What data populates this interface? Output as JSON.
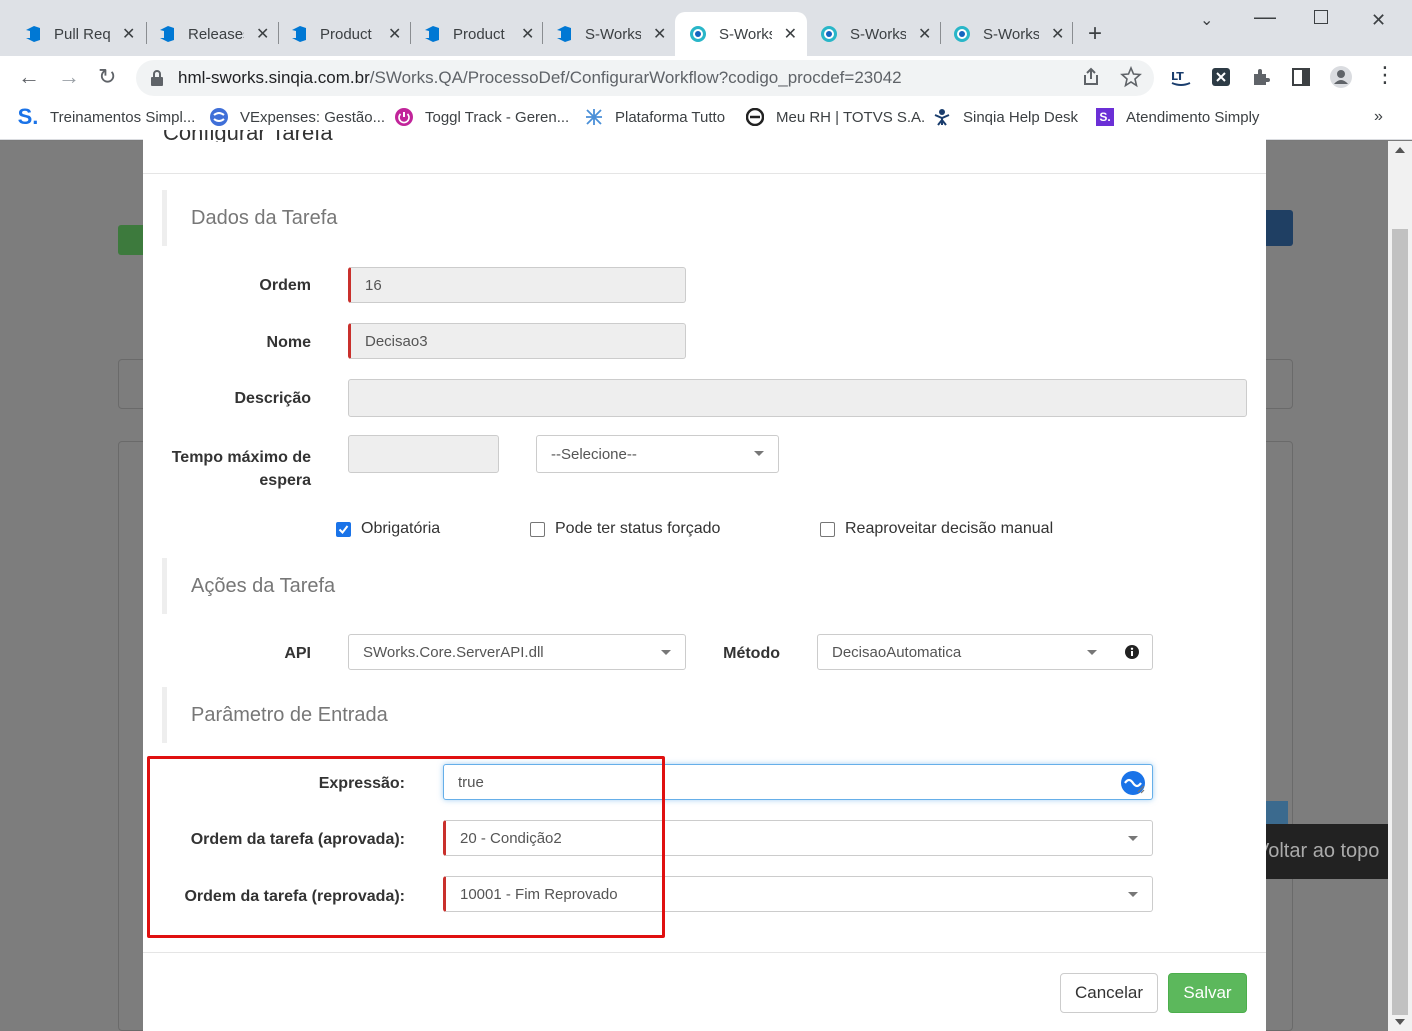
{
  "browser": {
    "tabs": [
      {
        "label": "Pull Requ",
        "icon": "azure-devops-icon",
        "active": false
      },
      {
        "label": "Releases",
        "icon": "azure-devops-icon",
        "active": false
      },
      {
        "label": "Product",
        "icon": "azure-devops-icon",
        "active": false
      },
      {
        "label": "Product",
        "icon": "azure-devops-icon",
        "active": false
      },
      {
        "label": "S-Works",
        "icon": "azure-devops-icon",
        "active": false
      },
      {
        "label": "S-Works",
        "icon": "sworks-icon",
        "active": true
      },
      {
        "label": "S-Works",
        "icon": "sworks-icon",
        "active": false
      },
      {
        "label": "S-Works",
        "icon": "sworks-icon",
        "active": false
      }
    ],
    "url_host": "hml-sworks.sinqia.com.br",
    "url_path": "/SWorks.QA/ProcessoDef/ConfigurarWorkflow?codigo_procdef=23042",
    "bookmarks": [
      {
        "label": "Treinamentos Simpl...",
        "icon": "sinqia-s-icon"
      },
      {
        "label": "VExpenses: Gestão...",
        "icon": "vexpenses-icon"
      },
      {
        "label": "Toggl Track - Geren...",
        "icon": "toggl-icon"
      },
      {
        "label": "Plataforma Tutto",
        "icon": "tutto-icon"
      },
      {
        "label": "Meu RH | TOTVS S.A.",
        "icon": "totvs-icon"
      },
      {
        "label": "Sinqia Help Desk",
        "icon": "helpdesk-icon"
      },
      {
        "label": "Atendimento Simply",
        "icon": "simply-icon"
      }
    ],
    "bookmarks_more": "»"
  },
  "background": {
    "to_top_label": "Voltar ao topo"
  },
  "modal": {
    "title": "Configurar Tarefa",
    "sections": {
      "dados": "Dados da Tarefa",
      "acoes": "Ações da Tarefa",
      "parametro": "Parâmetro de Entrada"
    },
    "labels": {
      "ordem": "Ordem",
      "nome": "Nome",
      "descricao": "Descrição",
      "tempo_line1": "Tempo máximo de",
      "tempo_line2": "espera",
      "api": "API",
      "metodo": "Método",
      "expressao": "Expressão:",
      "ordem_aprovada": "Ordem da tarefa (aprovada):",
      "ordem_reprovada": "Ordem da tarefa (reprovada):"
    },
    "values": {
      "ordem": "16",
      "nome": "Decisao3",
      "descricao": "",
      "tempo": "",
      "tempo_unit": "--Selecione--",
      "api": "SWorks.Core.ServerAPI.dll",
      "metodo": "DecisaoAutomatica",
      "expressao": "true",
      "ordem_aprovada": "20 - Condição2",
      "ordem_reprovada": "10001 - Fim Reprovado"
    },
    "checkboxes": {
      "obrigatoria": {
        "label": "Obrigatória",
        "checked": true
      },
      "status_forcado": {
        "label": "Pode ter status forçado",
        "checked": false
      },
      "reaproveitar": {
        "label": "Reaproveitar decisão manual",
        "checked": false
      }
    },
    "buttons": {
      "cancel": "Cancelar",
      "save": "Salvar"
    }
  }
}
